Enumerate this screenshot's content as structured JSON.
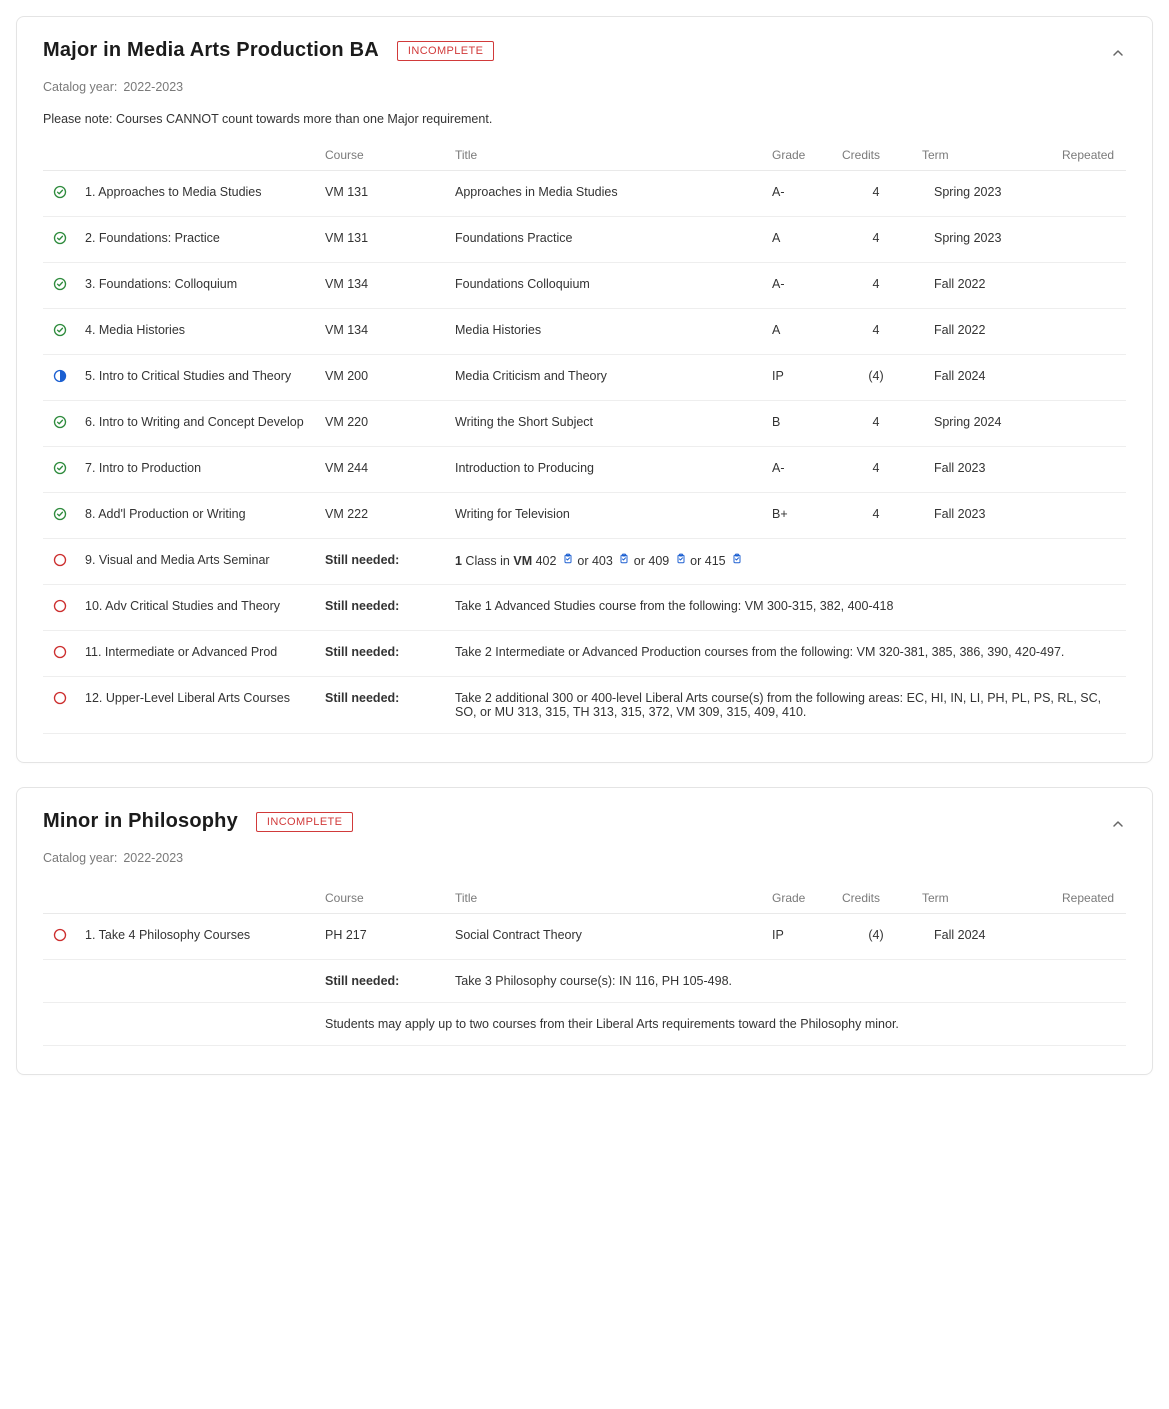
{
  "sections": [
    {
      "title": "Major in Media Arts Production BA",
      "status": "INCOMPLETE",
      "catalog_label": "Catalog year:",
      "catalog_value": "2022-2023",
      "note": "Please note: Courses CANNOT count towards more than one Major requirement.",
      "headers": {
        "course": "Course",
        "title": "Title",
        "grade": "Grade",
        "credits": "Credits",
        "term": "Term",
        "repeated": "Repeated"
      },
      "rows": [
        {
          "status": "complete",
          "req": "1. Approaches to Media Studies",
          "course": "VM 131",
          "title": "Approaches in Media Studies",
          "grade": "A-",
          "credits": "4",
          "term": "Spring 2023"
        },
        {
          "status": "complete",
          "req": "2. Foundations: Practice",
          "course": "VM 131",
          "title": "Foundations Practice",
          "grade": "A",
          "credits": "4",
          "term": "Spring 2023"
        },
        {
          "status": "complete",
          "req": "3. Foundations: Colloquium",
          "course": "VM 134",
          "title": "Foundations Colloquium",
          "grade": "A-",
          "credits": "4",
          "term": "Fall 2022"
        },
        {
          "status": "complete",
          "req": "4. Media Histories",
          "course": "VM 134",
          "title": "Media Histories",
          "grade": "A",
          "credits": "4",
          "term": "Fall 2022"
        },
        {
          "status": "inprogress",
          "req": "5. Intro to Critical Studies and Theory",
          "course": "VM 200",
          "title": "Media Criticism and Theory",
          "grade": "IP",
          "credits": "(4)",
          "term": "Fall 2024"
        },
        {
          "status": "complete",
          "req": "6. Intro to Writing and Concept Develop",
          "course": "VM 220",
          "title": "Writing the Short Subject",
          "grade": "B",
          "credits": "4",
          "term": "Spring 2024"
        },
        {
          "status": "complete",
          "req": "7. Intro to Production",
          "course": "VM 244",
          "title": "Introduction to Producing",
          "grade": "A-",
          "credits": "4",
          "term": "Fall 2023"
        },
        {
          "status": "complete",
          "req": "8. Add'l Production or Writing",
          "course": "VM 222",
          "title": "Writing for Television",
          "grade": "B+",
          "credits": "4",
          "term": "Fall 2023"
        },
        {
          "status": "needed",
          "req": "9. Visual and Media Arts Seminar",
          "course_label": "Still needed:",
          "needed_html": "<strong>1</strong> Class in <strong>VM</strong> 402 {clip} or 403 {clip} or 409 {clip} or 415 {clip}"
        },
        {
          "status": "needed",
          "req": "10. Adv Critical Studies and Theory",
          "course_label": "Still needed:",
          "needed_text": "Take 1 Advanced Studies course from the following: VM 300-315, 382, 400-418"
        },
        {
          "status": "needed",
          "req": "11. Intermediate or Advanced Prod",
          "course_label": "Still needed:",
          "needed_text": "Take 2 Intermediate or Advanced Production courses from the following: VM 320-381, 385, 386, 390, 420-497."
        },
        {
          "status": "needed",
          "req": "12. Upper-Level Liberal Arts Courses",
          "course_label": "Still needed:",
          "needed_text": "Take 2 additional 300 or 400-level Liberal Arts course(s) from the following areas: EC, HI, IN, LI, PH, PL, PS, RL, SC, SO, or MU 313, 315, TH 313, 315, 372, VM 309, 315, 409, 410."
        }
      ]
    },
    {
      "title": "Minor in Philosophy",
      "status": "INCOMPLETE",
      "catalog_label": "Catalog year:",
      "catalog_value": "2022-2023",
      "headers": {
        "course": "Course",
        "title": "Title",
        "grade": "Grade",
        "credits": "Credits",
        "term": "Term",
        "repeated": "Repeated"
      },
      "rows": [
        {
          "status": "needed",
          "req": "1. Take 4 Philosophy Courses",
          "sub": [
            {
              "course": "PH 217",
              "title": "Social Contract Theory",
              "grade": "IP",
              "credits": "(4)",
              "term": "Fall 2024"
            },
            {
              "course_label": "Still needed:",
              "needed_text": "Take 3 Philosophy course(s): IN 116, PH 105-498."
            },
            {
              "plain": "Students may apply up to two courses from their Liberal Arts requirements toward the Philosophy minor."
            }
          ]
        }
      ]
    }
  ]
}
